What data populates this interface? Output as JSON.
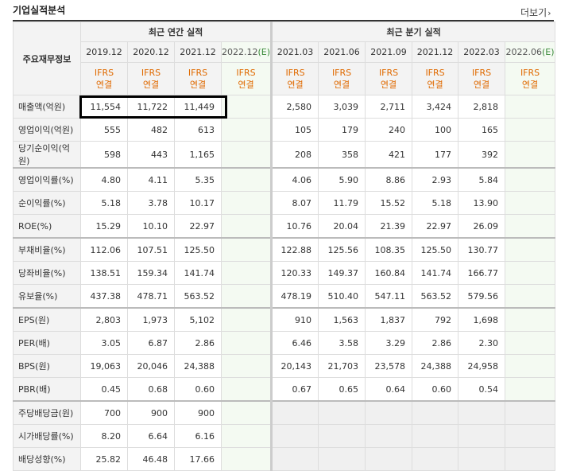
{
  "section_title": "기업실적분석",
  "more_label": "더보기",
  "corner_label": "주요재무정보",
  "group_headers": {
    "annual": "최근 연간 실적",
    "quarterly": "최근 분기 실적"
  },
  "annual_periods": [
    {
      "label": "2019.12",
      "est": ""
    },
    {
      "label": "2020.12",
      "est": ""
    },
    {
      "label": "2021.12",
      "est": ""
    },
    {
      "label": "2022.12",
      "est": "(E)"
    }
  ],
  "quarterly_periods": [
    {
      "label": "2021.03",
      "est": ""
    },
    {
      "label": "2021.06",
      "est": ""
    },
    {
      "label": "2021.09",
      "est": ""
    },
    {
      "label": "2021.12",
      "est": ""
    },
    {
      "label": "2022.03",
      "est": ""
    },
    {
      "label": "2022.06",
      "est": "(E)"
    }
  ],
  "ifrs_line1": "IFRS",
  "ifrs_line2": "연결",
  "rows": [
    {
      "label": "매출액(억원)",
      "annual": [
        "11,554",
        "11,722",
        "11,449",
        ""
      ],
      "quarterly": [
        "2,580",
        "3,039",
        "2,711",
        "3,424",
        "2,818",
        ""
      ]
    },
    {
      "label": "영업이익(억원)",
      "annual": [
        "555",
        "482",
        "613",
        ""
      ],
      "quarterly": [
        "105",
        "179",
        "240",
        "100",
        "165",
        ""
      ]
    },
    {
      "label": "당기순이익(억원)",
      "annual": [
        "598",
        "443",
        "1,165",
        ""
      ],
      "quarterly": [
        "208",
        "358",
        "421",
        "177",
        "392",
        ""
      ]
    },
    {
      "label": "영업이익률(%)",
      "annual": [
        "4.80",
        "4.11",
        "5.35",
        ""
      ],
      "quarterly": [
        "4.06",
        "5.90",
        "8.86",
        "2.93",
        "5.84",
        ""
      ]
    },
    {
      "label": "순이익률(%)",
      "annual": [
        "5.18",
        "3.78",
        "10.17",
        ""
      ],
      "quarterly": [
        "8.07",
        "11.79",
        "15.52",
        "5.18",
        "13.90",
        ""
      ]
    },
    {
      "label": "ROE(%)",
      "annual": [
        "15.29",
        "10.10",
        "22.97",
        ""
      ],
      "quarterly": [
        "10.76",
        "20.04",
        "21.39",
        "22.97",
        "26.09",
        ""
      ]
    },
    {
      "label": "부채비율(%)",
      "annual": [
        "112.06",
        "107.51",
        "125.50",
        ""
      ],
      "quarterly": [
        "122.88",
        "125.56",
        "108.35",
        "125.50",
        "130.77",
        ""
      ]
    },
    {
      "label": "당좌비율(%)",
      "annual": [
        "138.51",
        "159.34",
        "141.74",
        ""
      ],
      "quarterly": [
        "120.33",
        "149.37",
        "160.84",
        "141.74",
        "166.77",
        ""
      ]
    },
    {
      "label": "유보율(%)",
      "annual": [
        "437.38",
        "478.71",
        "563.52",
        ""
      ],
      "quarterly": [
        "478.19",
        "510.40",
        "547.11",
        "563.52",
        "579.56",
        ""
      ]
    },
    {
      "label": "EPS(원)",
      "annual": [
        "2,803",
        "1,973",
        "5,102",
        ""
      ],
      "quarterly": [
        "910",
        "1,563",
        "1,837",
        "792",
        "1,698",
        ""
      ]
    },
    {
      "label": "PER(배)",
      "annual": [
        "3.05",
        "6.87",
        "2.86",
        ""
      ],
      "quarterly": [
        "6.46",
        "3.58",
        "3.29",
        "2.86",
        "2.30",
        ""
      ]
    },
    {
      "label": "BPS(원)",
      "annual": [
        "19,063",
        "20,046",
        "24,388",
        ""
      ],
      "quarterly": [
        "20,143",
        "21,703",
        "23,578",
        "24,388",
        "24,958",
        ""
      ]
    },
    {
      "label": "PBR(배)",
      "annual": [
        "0.45",
        "0.68",
        "0.60",
        ""
      ],
      "quarterly": [
        "0.67",
        "0.65",
        "0.64",
        "0.60",
        "0.54",
        ""
      ]
    },
    {
      "label": "주당배당금(원)",
      "annual": [
        "700",
        "900",
        "900",
        ""
      ],
      "quarterly": []
    },
    {
      "label": "시가배당률(%)",
      "annual": [
        "8.20",
        "6.64",
        "6.16",
        ""
      ],
      "quarterly": []
    },
    {
      "label": "배당성향(%)",
      "annual": [
        "25.82",
        "46.48",
        "17.66",
        ""
      ],
      "quarterly": []
    }
  ]
}
